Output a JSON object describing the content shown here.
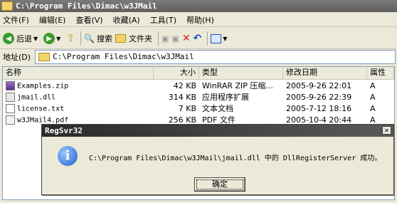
{
  "window": {
    "title": "C:\\Program Files\\Dimac\\w3JMail"
  },
  "menu": [
    "文件(F)",
    "编辑(E)",
    "查看(V)",
    "收藏(A)",
    "工具(T)",
    "帮助(H)"
  ],
  "toolbar": {
    "back": "后退",
    "search": "搜索",
    "folders": "文件夹"
  },
  "address": {
    "label": "地址(D)",
    "value": "C:\\Program Files\\Dimac\\w3JMail"
  },
  "columns": {
    "name": "名称",
    "size": "大小",
    "type": "类型",
    "modified": "修改日期",
    "attr": "属性"
  },
  "files": [
    {
      "name": "Examples.zip",
      "size": "42 KB",
      "type": "WinRAR ZIP 压缩...",
      "modified": "2005-9-26 22:01",
      "attr": "A"
    },
    {
      "name": "jmail.dll",
      "size": "314 KB",
      "type": "应用程序扩展",
      "modified": "2005-9-26 22:39",
      "attr": "A"
    },
    {
      "name": "license.txt",
      "size": "7 KB",
      "type": "文本文档",
      "modified": "2005-7-12 18:16",
      "attr": "A"
    },
    {
      "name": "w3JMail4.pdf",
      "size": "256 KB",
      "type": "PDF 文件",
      "modified": "2005-10-4 20:44",
      "attr": "A"
    }
  ],
  "dialog": {
    "title": "RegSvr32",
    "message": "C:\\Program Files\\Dimac\\w3JMail\\jmail.dll 中的 DllRegisterServer 成功。",
    "ok": "确定",
    "close_icon": "✕"
  }
}
